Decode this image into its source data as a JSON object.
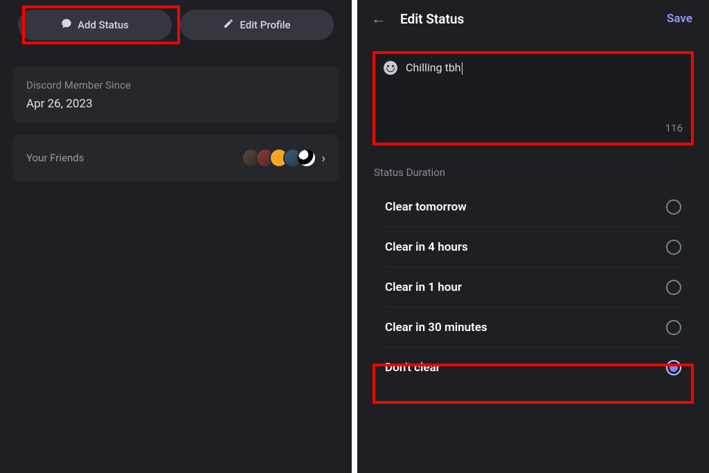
{
  "leftPanel": {
    "addStatusLabel": "Add Status",
    "editProfileLabel": "Edit Profile",
    "memberSince": {
      "label": "Discord Member Since",
      "value": "Apr 26, 2023"
    },
    "friends": {
      "label": "Your Friends"
    }
  },
  "rightPanel": {
    "title": "Edit Status",
    "saveLabel": "Save",
    "statusText": "Chilling tbh",
    "charCount": "116",
    "durationSectionLabel": "Status Duration",
    "durations": [
      {
        "label": "Clear tomorrow",
        "selected": false
      },
      {
        "label": "Clear in 4 hours",
        "selected": false
      },
      {
        "label": "Clear in 1 hour",
        "selected": false
      },
      {
        "label": "Clear in 30 minutes",
        "selected": false
      },
      {
        "label": "Don't clear",
        "selected": true
      }
    ]
  },
  "colors": {
    "accent": "#9499f5",
    "highlight": "#ff0000"
  }
}
